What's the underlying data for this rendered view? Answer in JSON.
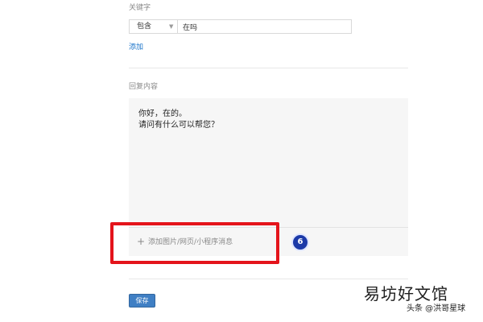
{
  "keyword_section": {
    "label": "关键字",
    "match_mode": "包含",
    "caret": "▼",
    "keyword_value": "在吗",
    "add_link": "添加"
  },
  "reply_section": {
    "label": "回复内容",
    "lines": [
      "你好，在的。",
      "请问有什么可以帮您？"
    ],
    "attach_icon": "+",
    "attach_text": "添加图片/网页/小程序消息"
  },
  "annotation": {
    "step_number": "6",
    "highlight_color": "#e4141b",
    "badge_color": "#1c3aa8"
  },
  "actions": {
    "save_label": "保存"
  },
  "watermark": {
    "main": "易坊好文馆",
    "sub": "头条 @洪哥星球"
  },
  "colors": {
    "link": "#1a73c9",
    "primary_button": "#3f7fc4",
    "reply_background": "#f6f6f6"
  }
}
